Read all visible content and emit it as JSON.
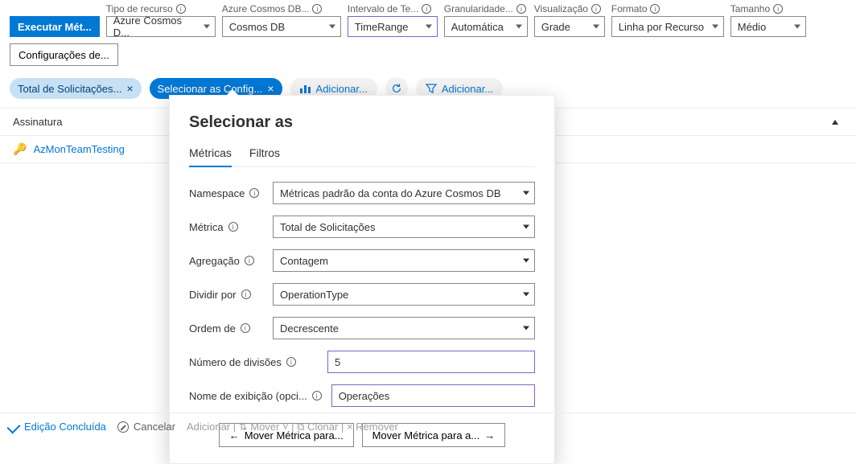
{
  "header": {
    "run_label": "Executar Mét...",
    "params": [
      {
        "label": "Tipo de recurso",
        "value": "Azure Cosmos D...",
        "accent": false
      },
      {
        "label": "Azure Cosmos DB...",
        "value": "Cosmos DB",
        "accent": false
      },
      {
        "label": "Intervalo de Te...",
        "value": "TimeRange",
        "accent": true
      },
      {
        "label": "Granularidade...",
        "value": "Automática",
        "accent": false
      },
      {
        "label": "Visualização",
        "value": "Grade",
        "accent": false
      },
      {
        "label": "Formato",
        "value": "Linha por Recurso",
        "accent": false
      },
      {
        "label": "Tamanho",
        "value": "Médio",
        "accent": false
      }
    ]
  },
  "settings_btn": "Configurações de...",
  "pills": {
    "metric1": "Total de Solicitações...",
    "metric2": "Selecionar as Config...",
    "add": "Adicionar...",
    "addFilter": "Adicionar..."
  },
  "table": {
    "header": "Assinatura",
    "row": "AzMonTeamTesting"
  },
  "popover": {
    "title": "Selecionar as",
    "tab_metrics": "Métricas",
    "tab_filters": "Filtros",
    "fields": {
      "namespace_label": "Namespace",
      "namespace_value": "Métricas padrão da conta do Azure Cosmos DB",
      "metric_label": "Métrica",
      "metric_value": "Total de Solicitações",
      "aggr_label": "Agregação",
      "aggr_value": "Contagem",
      "split_label": "Dividir por",
      "split_value": "OperationType",
      "order_label": "Ordem de",
      "order_value": "Decrescente",
      "limit_label": "Número de divisões",
      "limit_value": "5",
      "display_label": "Nome de exibição (opci...",
      "display_value": "Operações"
    },
    "move_left": "Mover Métrica para...",
    "move_right": "Mover Métrica para a..."
  },
  "bottom": {
    "done": "Edição Concluída",
    "cancel": "Cancelar",
    "faded": "Adicionar  |  ⇅ Mover ˅  |  ⧉ Clonar  |  × Remover"
  }
}
